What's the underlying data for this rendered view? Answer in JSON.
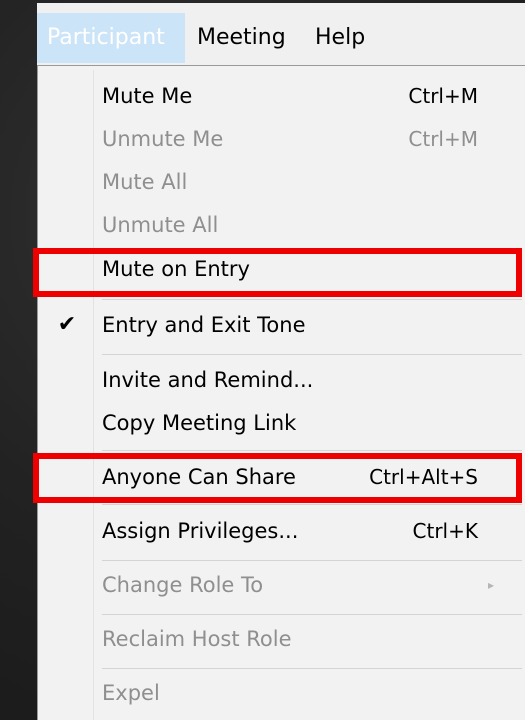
{
  "menubar": {
    "participant_label": "Participant",
    "meeting_label": "Meeting",
    "help_label": "Help"
  },
  "menu": {
    "mute_me": {
      "label": "Mute Me",
      "shortcut": "Ctrl+M"
    },
    "unmute_me": {
      "label": "Unmute Me",
      "shortcut": "Ctrl+M"
    },
    "mute_all": {
      "label": "Mute All"
    },
    "unmute_all": {
      "label": "Unmute All"
    },
    "mute_on_entry": {
      "label": "Mute on Entry"
    },
    "entry_exit_tone": {
      "label": "Entry and Exit Tone",
      "checked": true
    },
    "invite_remind": {
      "label": "Invite and Remind..."
    },
    "copy_link": {
      "label": "Copy Meeting Link"
    },
    "anyone_can_share": {
      "label": "Anyone Can Share",
      "shortcut": "Ctrl+Alt+S"
    },
    "assign_privileges": {
      "label": "Assign Privileges...",
      "shortcut": "Ctrl+K"
    },
    "change_role": {
      "label": "Change Role To"
    },
    "reclaim_host": {
      "label": "Reclaim Host Role"
    },
    "expel": {
      "label": "Expel"
    }
  },
  "icons": {
    "checkmark": "checkmark-icon",
    "submenu": "chevron-right-icon"
  },
  "colors": {
    "highlight": "#ee0000",
    "menu_bg": "#f2f2f2",
    "active_menubar": "#cce4f7",
    "disabled_text": "#8f8f8f"
  }
}
